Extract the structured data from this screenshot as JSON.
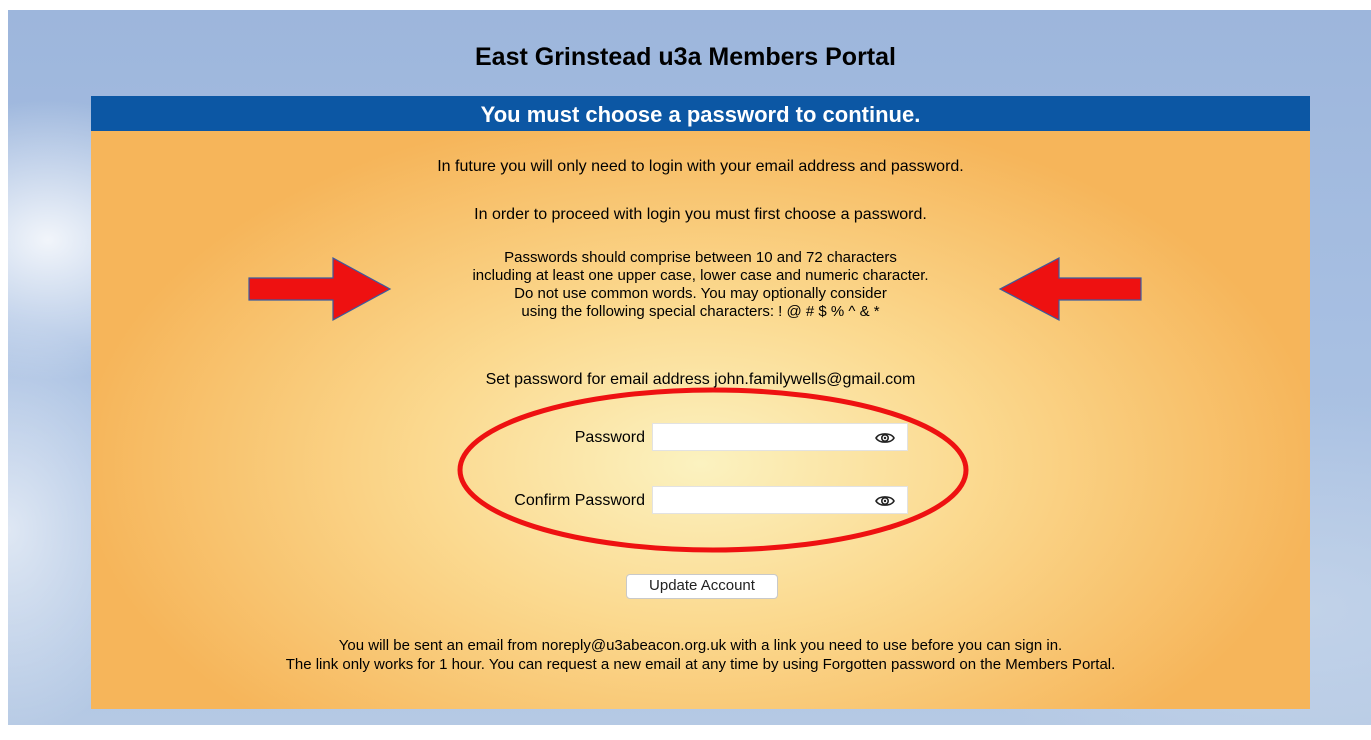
{
  "page": {
    "title": "East Grinstead u3a Members Portal"
  },
  "panel": {
    "banner": "You must choose a password to continue.",
    "info_line_1": "In future you will only need to login with your email address and password.",
    "info_line_2": "In order to proceed with login you must first choose a password.",
    "rules": [
      "Passwords should comprise between 10 and 72 characters",
      "including at least one upper case, lower case and numeric character.",
      "Do not use common words. You may optionally consider",
      "using the following special characters: ! @ # $ % ^ & *"
    ],
    "email_line": "Set password for email address john.familywells@gmail.com",
    "password": {
      "label": "Password",
      "value": "",
      "icon": "eye-icon"
    },
    "confirm_password": {
      "label": "Confirm Password",
      "value": "",
      "icon": "eye-icon"
    },
    "update_button": "Update Account",
    "footer": [
      "You will be sent an email from noreply@u3abeacon.org.uk with a link you need to use before you can sign in.",
      "The link only works for 1 hour. You can request a new email at any time by using Forgotten password on the Members Portal."
    ]
  },
  "colors": {
    "banner": "#0c57a4",
    "panel_edge": "#f6b55a",
    "panel_center": "#fbf2c0",
    "annotation": "#ee1111"
  }
}
